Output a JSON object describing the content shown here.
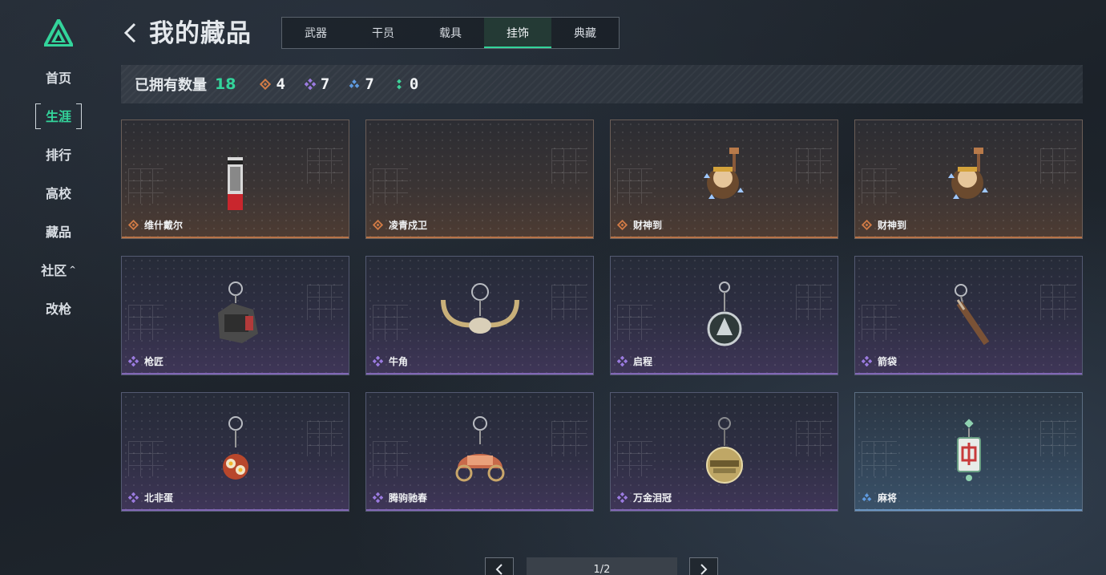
{
  "sidebar": {
    "items": [
      {
        "label": "首页",
        "active": false
      },
      {
        "label": "生涯",
        "active": true
      },
      {
        "label": "排行",
        "active": false
      },
      {
        "label": "高校",
        "active": false
      },
      {
        "label": "藏品",
        "active": false
      },
      {
        "label": "社区",
        "active": false
      },
      {
        "label": "改枪",
        "active": false
      }
    ]
  },
  "header": {
    "title": "我的藏品",
    "tabs": [
      {
        "label": "武器",
        "active": false
      },
      {
        "label": "干员",
        "active": false
      },
      {
        "label": "载具",
        "active": false
      },
      {
        "label": "挂饰",
        "active": true
      },
      {
        "label": "典藏",
        "active": false
      }
    ]
  },
  "stats": {
    "label": "已拥有数量",
    "total": "18",
    "rarities": [
      {
        "rarity": "orange",
        "count": "4",
        "color": "#d07a45"
      },
      {
        "rarity": "purple",
        "count": "7",
        "color": "#9b7be0"
      },
      {
        "rarity": "blue",
        "count": "7",
        "color": "#5f9be0"
      },
      {
        "rarity": "green",
        "count": "0",
        "color": "#3fd39a"
      }
    ]
  },
  "items": [
    {
      "name": "维什戴尔",
      "rarity": "orange"
    },
    {
      "name": "凌青戍卫",
      "rarity": "orange"
    },
    {
      "name": "财神到",
      "rarity": "orange"
    },
    {
      "name": "财神到",
      "rarity": "orange"
    },
    {
      "name": "枪匠",
      "rarity": "purple"
    },
    {
      "name": "牛角",
      "rarity": "purple"
    },
    {
      "name": "启程",
      "rarity": "purple"
    },
    {
      "name": "箭袋",
      "rarity": "purple"
    },
    {
      "name": "北非蛋",
      "rarity": "purple"
    },
    {
      "name": "腾驹驰春",
      "rarity": "purple"
    },
    {
      "name": "万金泪冠",
      "rarity": "purple"
    },
    {
      "name": "麻将",
      "rarity": "blue"
    }
  ],
  "pagination": {
    "current": "1/2"
  },
  "colors": {
    "accent": "#33d49b"
  }
}
